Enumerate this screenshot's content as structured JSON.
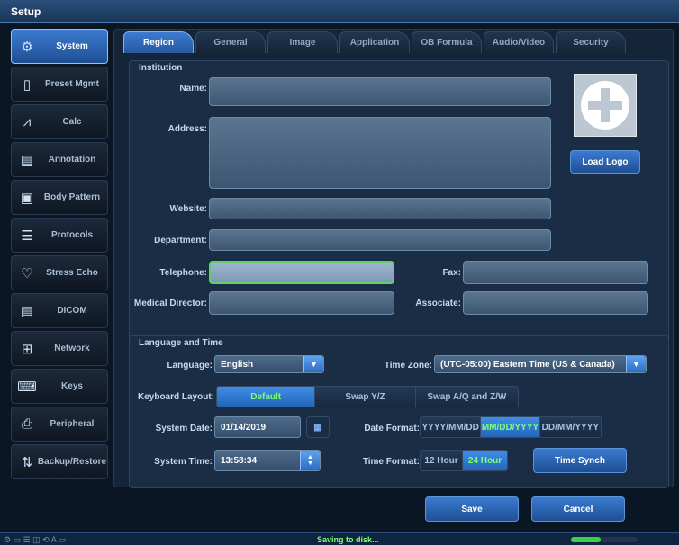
{
  "window": {
    "title": "Setup"
  },
  "sidebar": {
    "items": [
      {
        "label": "System",
        "icon": "gear-icon",
        "glyph": "⚙",
        "active": true
      },
      {
        "label": "Preset Mgmt",
        "icon": "preset-icon",
        "glyph": "▯"
      },
      {
        "label": "Calc",
        "icon": "calc-icon",
        "glyph": "⩘"
      },
      {
        "label": "Annotation",
        "icon": "annotation-icon",
        "glyph": "▤"
      },
      {
        "label": "Body Pattern",
        "icon": "body-pattern-icon",
        "glyph": "▣"
      },
      {
        "label": "Protocols",
        "icon": "protocols-icon",
        "glyph": "☰"
      },
      {
        "label": "Stress Echo",
        "icon": "heart-icon",
        "glyph": "♡"
      },
      {
        "label": "DICOM",
        "icon": "dicom-icon",
        "glyph": "▤"
      },
      {
        "label": "Network",
        "icon": "network-icon",
        "glyph": "⊞"
      },
      {
        "label": "Keys",
        "icon": "keys-icon",
        "glyph": "⌨"
      },
      {
        "label": "Peripheral",
        "icon": "peripheral-icon",
        "glyph": "⎙"
      },
      {
        "label": "Backup/Restore",
        "icon": "backup-icon",
        "glyph": "⇅"
      }
    ]
  },
  "tabs": [
    {
      "label": "Region",
      "active": true
    },
    {
      "label": "General"
    },
    {
      "label": "Image"
    },
    {
      "label": "Application"
    },
    {
      "label": "OB Formula"
    },
    {
      "label": "Audio/Video"
    },
    {
      "label": "Security"
    }
  ],
  "institution": {
    "title": "Institution",
    "name_label": "Name:",
    "name_value": "",
    "address_label": "Address:",
    "address_value": "",
    "website_label": "Website:",
    "website_value": "",
    "department_label": "Department:",
    "department_value": "",
    "telephone_label": "Telephone:",
    "telephone_value": "",
    "fax_label": "Fax:",
    "fax_value": "",
    "director_label": "Medical Director:",
    "director_value": "",
    "associate_label": "Associate:",
    "associate_value": "",
    "load_logo": "Load Logo"
  },
  "lang_time": {
    "title": "Language and Time",
    "language_label": "Language:",
    "language_value": "English",
    "timezone_label": "Time Zone:",
    "timezone_value": "(UTC-05:00) Eastern Time (US & Canada)",
    "keyboard_label": "Keyboard Layout:",
    "keyboard_options": [
      "Default",
      "Swap Y/Z",
      "Swap A/Q and Z/W"
    ],
    "keyboard_selected": "Default",
    "date_label": "System Date:",
    "date_value": "01/14/2019",
    "date_format_label": "Date Format:",
    "date_formats": [
      "YYYY/MM/DD",
      "MM/DD/YYYY",
      "DD/MM/YYYY"
    ],
    "date_format_selected": "MM/DD/YYYY",
    "time_label": "System Time:",
    "time_value": "13:58:34",
    "time_format_label": "Time Format:",
    "time_formats": [
      "12 Hour",
      "24 Hour"
    ],
    "time_format_selected": "24 Hour",
    "time_synch": "Time Synch"
  },
  "footer": {
    "save": "Save",
    "cancel": "Cancel"
  },
  "statusbar": {
    "text": "Saving to disk...",
    "progress": 0.45
  },
  "colors": {
    "accent": "#3b7bd0",
    "selected_text": "#7dff74",
    "background": "#14253a"
  }
}
